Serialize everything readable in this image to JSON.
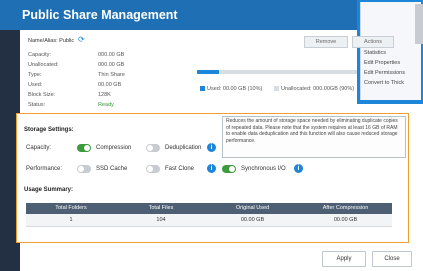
{
  "window": {
    "title": "Public Share Management"
  },
  "share": {
    "name_label": "Name/Alias: Public",
    "rows": [
      {
        "key": "Capacity:",
        "value": "000.00 GB"
      },
      {
        "key": "Unallocated:",
        "value": "000.00 GB"
      },
      {
        "key": "Type:",
        "value": "Thin Share"
      },
      {
        "key": "Used:",
        "value": "00.00 GB"
      },
      {
        "key": "Block Size:",
        "value": "128K"
      },
      {
        "key": "Status:",
        "value": "Ready"
      }
    ]
  },
  "top_buttons": {
    "b1": "Remove",
    "b2": "Actions"
  },
  "right_panel": {
    "items": [
      "Statistics",
      "Edit Properties",
      "Edit Permissions",
      "Convert to Thick"
    ]
  },
  "usage": {
    "used_fraction": 0.14,
    "used_label": "Used: 00.00 GB (10%)",
    "unallocated_label": "Unallocated: 000.00GB (90%)",
    "colors": {
      "used": "#1d86d8",
      "unallocated": "#d7dde3"
    }
  },
  "storage_settings": {
    "title": "Storage Settings:",
    "capacity_label": "Capacity:",
    "compression_label": "Compression",
    "deduplication_label": "Deduplication",
    "performance_label": "Performance:",
    "ssd_cache_label": "SSD Cache",
    "fast_clone_label": "Fast Clone",
    "synchronous_io_label": "Synchronous I/O",
    "tooltip": "Reduces the amount of storage space needed by eliminating duplicate copies of repeated data. Please note that the system requires at least 16 GB of RAM to enable data deduplication and this function will also cause reduced storage performance."
  },
  "usage_summary": {
    "title": "Usage Summary:",
    "headers": [
      "Total Folders",
      "Total Files",
      "Original Used",
      "After Compression"
    ],
    "row": [
      "1",
      "104",
      "00.00 GB",
      "00.00 GB"
    ]
  },
  "footer": {
    "apply": "Apply",
    "close": "Close"
  }
}
